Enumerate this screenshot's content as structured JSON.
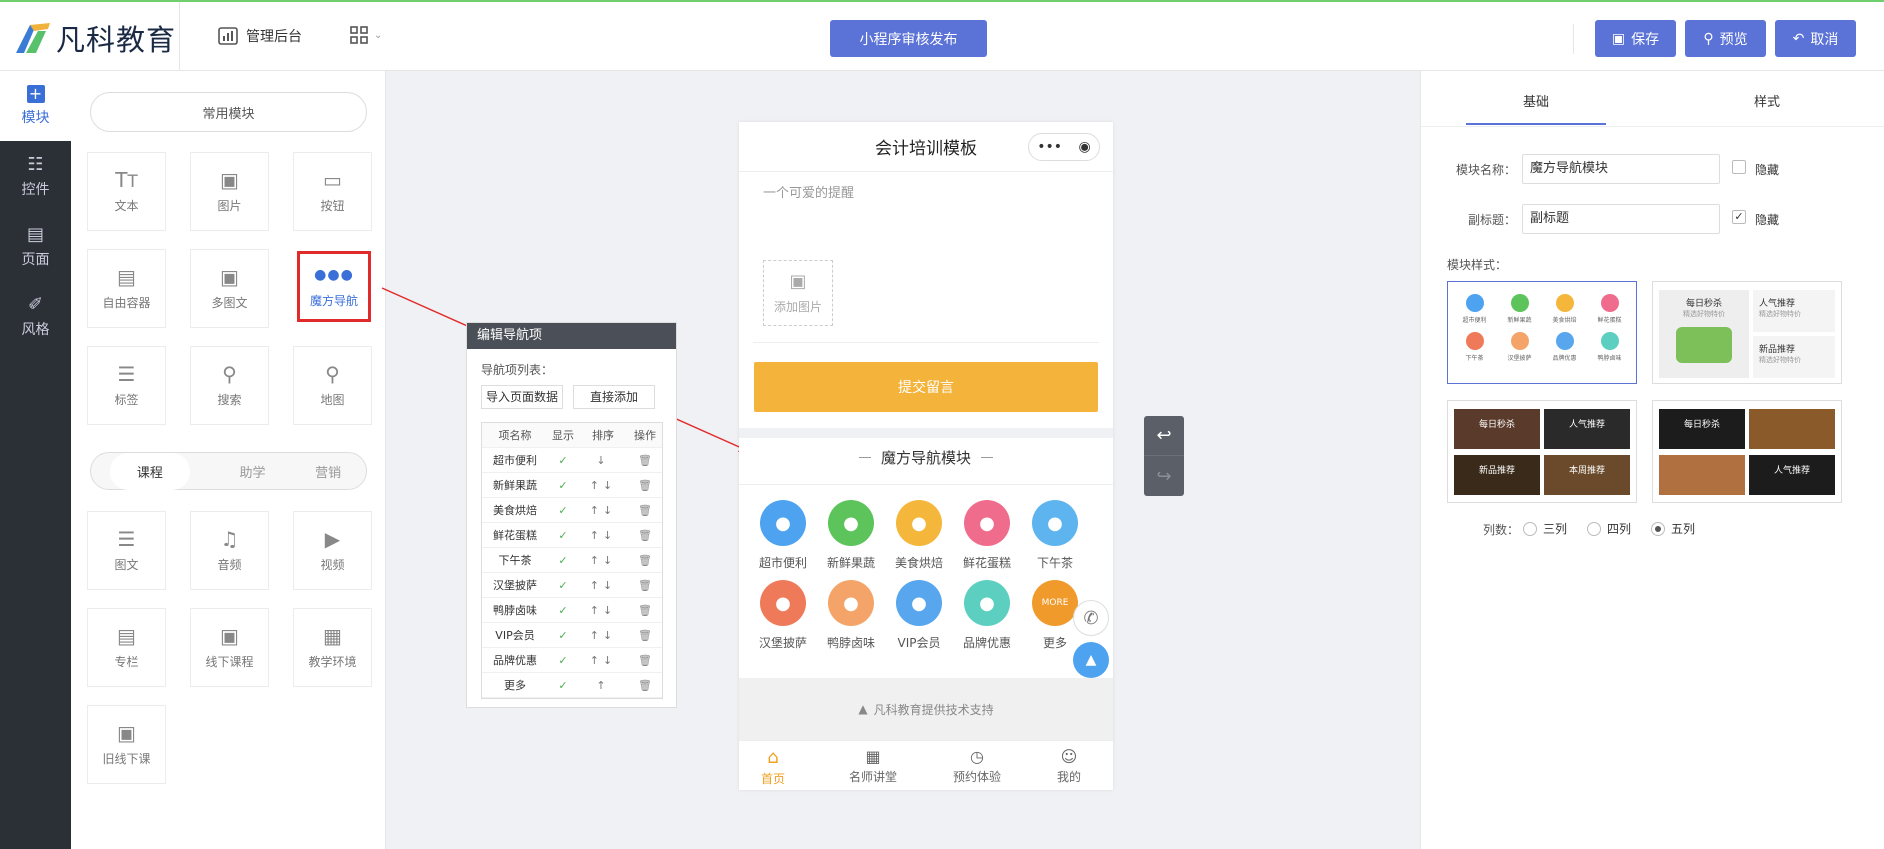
{
  "header": {
    "brand": "凡科教育",
    "admin_label": "管理后台",
    "publish_label": "小程序审核发布",
    "save_label": "保存",
    "preview_label": "预览",
    "cancel_label": "取消"
  },
  "sidebar": {
    "items": [
      {
        "label": "模块",
        "icon": "plus-icon"
      },
      {
        "label": "控件",
        "icon": "sliders-icon"
      },
      {
        "label": "页面",
        "icon": "pages-icon"
      },
      {
        "label": "风格",
        "icon": "brush-icon"
      }
    ]
  },
  "modules": {
    "common_label": "常用模块",
    "common": [
      "文本",
      "图片",
      "按钮",
      "自由容器",
      "多图文",
      "魔方导航",
      "标签",
      "搜索",
      "地图"
    ],
    "tabs": [
      "课程",
      "助学",
      "营销"
    ],
    "course": [
      "图文",
      "音频",
      "视频",
      "专栏",
      "线下课程",
      "教学环境",
      "旧线下课"
    ]
  },
  "nav_editor": {
    "title": "编辑导航项",
    "list_label": "导航项列表：",
    "import_label": "导入页面数据",
    "add_label": "直接添加",
    "columns": [
      "项名称",
      "显示",
      "排序",
      "操作"
    ],
    "rows": [
      {
        "name": "超市便利",
        "sort": "↓"
      },
      {
        "name": "新鲜果蔬",
        "sort": "↑↓"
      },
      {
        "name": "美食烘焙",
        "sort": "↑↓"
      },
      {
        "name": "鲜花蛋糕",
        "sort": "↑↓"
      },
      {
        "name": "下午茶",
        "sort": "↑↓"
      },
      {
        "name": "汉堡披萨",
        "sort": "↑↓"
      },
      {
        "name": "鸭脖卤味",
        "sort": "↑↓"
      },
      {
        "name": "VIP会员",
        "sort": "↑↓"
      },
      {
        "name": "品牌优惠",
        "sort": "↑↓"
      },
      {
        "name": "更多",
        "sort": "↑"
      }
    ]
  },
  "phone": {
    "title": "会计培训模板",
    "reminder": "一个可爱的提醒",
    "add_image": "添加图片",
    "submit": "提交留言",
    "module_title": "魔方导航模块",
    "nav": [
      {
        "label": "超市便利",
        "color": "#4da3ef"
      },
      {
        "label": "新鲜果蔬",
        "color": "#5cc45a"
      },
      {
        "label": "美食烘焙",
        "color": "#f5b63c"
      },
      {
        "label": "鲜花蛋糕",
        "color": "#f06c8c"
      },
      {
        "label": "下午茶",
        "color": "#5db4ee"
      },
      {
        "label": "汉堡披萨",
        "color": "#ef7a5a"
      },
      {
        "label": "鸭脖卤味",
        "color": "#f4a468"
      },
      {
        "label": "VIP会员",
        "color": "#58a6ee"
      },
      {
        "label": "品牌优惠",
        "color": "#5ccfc0"
      },
      {
        "label": "更多",
        "color": "#f19a2c",
        "icon_text": "MORE"
      }
    ],
    "support": "凡科教育提供技术支持",
    "tabbar": [
      "首页",
      "名师讲堂",
      "预约体验",
      "我的"
    ]
  },
  "right": {
    "tabs": [
      "基础",
      "样式"
    ],
    "name_label": "模块名称：",
    "name_value": "魔方导航模块",
    "hide_label": "隐藏",
    "subtitle_label": "副标题：",
    "subtitle_value": "副标题",
    "style_label": "模块样式：",
    "style1_items": [
      "超市便利",
      "新鲜果蔬",
      "美食烘焙",
      "鲜花蛋糕",
      "下午茶",
      "汉堡披萨",
      "品牌优惠",
      "鸭脖卤味"
    ],
    "s2_a": "每日秒杀",
    "s2_a_sub": "精选好物特价",
    "s2_b": "人气推荐",
    "s2_b_sub": "精选好物特价",
    "s2_c": "新品推荐",
    "s2_c_sub": "精选好物特价",
    "s3": [
      "每日秒杀",
      "人气推荐",
      "新品推荐",
      "本周推荐"
    ],
    "s4": [
      "每日秒杀",
      "人气推荐"
    ],
    "cols_label": "列数：",
    "cols": [
      "三列",
      "四列",
      "五列"
    ],
    "accent": "#5b72d6"
  }
}
